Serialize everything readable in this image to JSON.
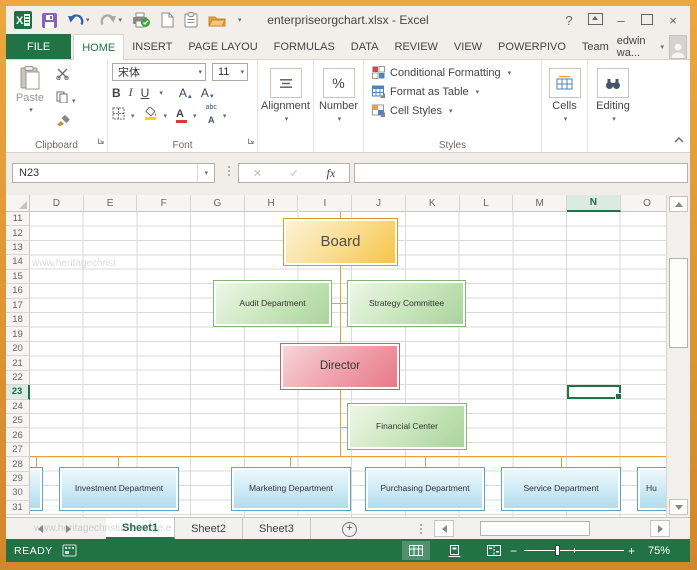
{
  "window": {
    "title": "enterpriseorgchart.xlsx - Excel",
    "controls": {
      "help": "?",
      "minimize": "–",
      "close": "×"
    }
  },
  "ribbon_tabs": [
    {
      "label": "FILE",
      "file": true
    },
    {
      "label": "HOME",
      "active": true
    },
    {
      "label": "INSERT"
    },
    {
      "label": "PAGE LAYOU"
    },
    {
      "label": "FORMULAS"
    },
    {
      "label": "DATA"
    },
    {
      "label": "REVIEW"
    },
    {
      "label": "VIEW"
    },
    {
      "label": "POWERPIVO"
    },
    {
      "label": "Team"
    }
  ],
  "user": {
    "name": "edwin wa..."
  },
  "ribbon": {
    "clipboard": {
      "label": "Clipboard",
      "paste": "Paste"
    },
    "font": {
      "label": "Font",
      "name": "宋体",
      "size": "11",
      "bold": "B",
      "italic": "I",
      "underline": "U",
      "phonetic": "abc"
    },
    "alignment": {
      "label": "Alignment"
    },
    "number": {
      "label": "Number",
      "symbol": "%"
    },
    "styles": {
      "label": "Styles",
      "items": [
        "Conditional Formatting",
        "Format as Table",
        "Cell Styles"
      ]
    },
    "cells": {
      "label": "Cells"
    },
    "editing": {
      "label": "Editing"
    }
  },
  "formula_bar": {
    "name_box": "N23",
    "cancel": "✕",
    "enter": "✓",
    "fx": "fx",
    "value": ""
  },
  "sheet": {
    "columns": [
      "D",
      "E",
      "F",
      "G",
      "H",
      "I",
      "J",
      "K",
      "L",
      "M",
      "N",
      "O"
    ],
    "active_column": "N",
    "row_start": 11,
    "row_end": 31,
    "active_row": 23,
    "active_cell": "N23"
  },
  "org_chart": {
    "nodes": [
      {
        "id": "board",
        "label": "Board",
        "color": "gold"
      },
      {
        "id": "audit",
        "label": "Audit Department",
        "color": "green"
      },
      {
        "id": "strategy",
        "label": "Strategy Committee",
        "color": "green"
      },
      {
        "id": "director",
        "label": "Director",
        "color": "red"
      },
      {
        "id": "financial",
        "label": "Financial Center",
        "color": "green"
      },
      {
        "id": "dept_clipped",
        "label": "",
        "color": "blue"
      },
      {
        "id": "investment",
        "label": "Investment Department",
        "color": "blue"
      },
      {
        "id": "marketing",
        "label": "Marketing Department",
        "color": "blue"
      },
      {
        "id": "purchasing",
        "label": "Purchasing Department",
        "color": "blue"
      },
      {
        "id": "service",
        "label": "Service Department",
        "color": "blue"
      },
      {
        "id": "hr",
        "label": "Hu",
        "color": "blue"
      }
    ]
  },
  "sheet_tabs": {
    "tabs": [
      "Sheet1",
      "Sheet2",
      "Sheet3"
    ],
    "active": "Sheet1",
    "add_label": "+"
  },
  "watermark": "www.heritagechristiancollege.e",
  "status_bar": {
    "mode": "READY",
    "zoom": "75%"
  },
  "colors": {
    "excel_green": "#217346",
    "connector": "#E2A33C",
    "gold_border": "#D99B28",
    "gold_fill_light": "#FEF4DC",
    "gold_fill_dark": "#F6C445",
    "green_border": "#7FB971",
    "green_fill_light": "#EFF8EA",
    "green_fill_dark": "#A9D39A",
    "red_border": "#C95E6C",
    "red_fill_light": "#F8D7DB",
    "red_fill_dark": "#E87687",
    "blue_border": "#58A7C6",
    "blue_fill_light": "#EFF9FD",
    "blue_fill_dark": "#ADDBEE"
  }
}
